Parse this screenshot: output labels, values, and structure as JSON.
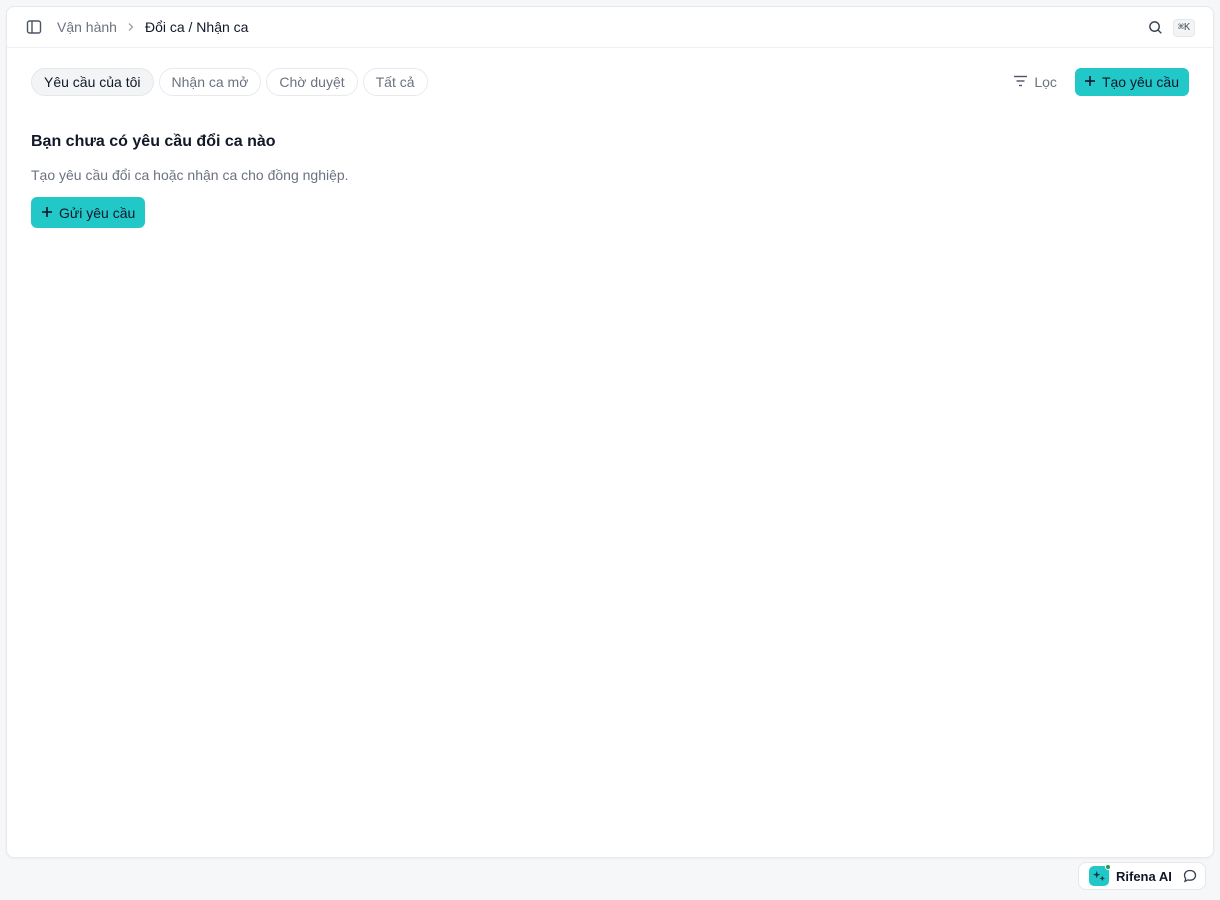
{
  "breadcrumb": {
    "parent": "Vận hành",
    "current": "Đổi ca / Nhận ca"
  },
  "search": {
    "shortcut": "⌘K"
  },
  "tabs": [
    {
      "label": "Yêu cầu của tôi",
      "active": true
    },
    {
      "label": "Nhận ca mở",
      "active": false
    },
    {
      "label": "Chờ duyệt",
      "active": false
    },
    {
      "label": "Tất cả",
      "active": false
    }
  ],
  "toolbar": {
    "filter_label": "Lọc",
    "create_label": "Tạo yêu cầu"
  },
  "empty_state": {
    "title": "Bạn chưa có yêu cầu đổi ca nào",
    "description": "Tạo yêu cầu đổi ca hoặc nhận ca cho đồng nghiệp.",
    "button_label": "Gửi yêu cầu"
  },
  "assistant": {
    "label": "Rifena AI"
  },
  "colors": {
    "accent": "#22c7c7",
    "online": "#16a34a"
  },
  "icons": {
    "sidebar_toggle": "sidebar-toggle-icon",
    "chevron": "chevron-right-icon",
    "search": "search-icon",
    "filter": "filter-icon",
    "plus": "plus-icon",
    "sparkle": "sparkle-icon",
    "chat": "chat-bubble-icon"
  }
}
